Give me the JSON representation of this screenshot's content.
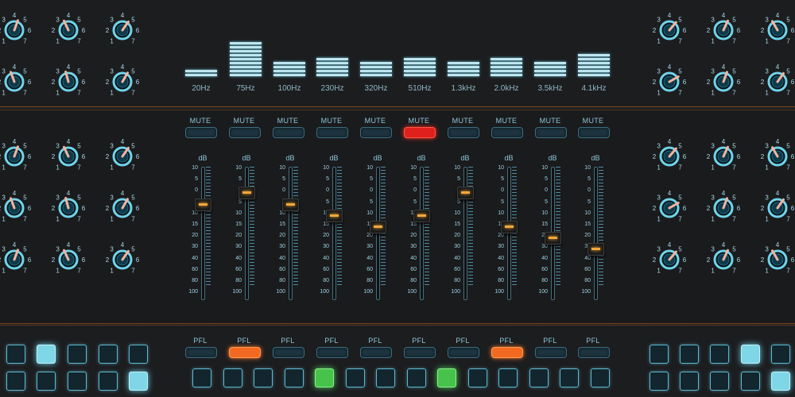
{
  "spectrum": {
    "bands": [
      {
        "label": "20Hz",
        "level": 2
      },
      {
        "label": "75Hz",
        "level": 9
      },
      {
        "label": "100Hz",
        "level": 4
      },
      {
        "label": "230Hz",
        "level": 5
      },
      {
        "label": "320Hz",
        "level": 4
      },
      {
        "label": "510Hz",
        "level": 5
      },
      {
        "label": "1.3kHz",
        "level": 4
      },
      {
        "label": "2.0kHz",
        "level": 5
      },
      {
        "label": "3.5kHz",
        "level": 4
      },
      {
        "label": "4.1kHz",
        "level": 6
      }
    ]
  },
  "knob_scale": [
    "1",
    "2",
    "3",
    "4",
    "5",
    "6",
    "7"
  ],
  "channels": [
    {
      "mute_label": "MUTE",
      "muted": false,
      "pfl_label": "PFL",
      "pfl": false,
      "db_label": "dB",
      "fader_db": 5
    },
    {
      "mute_label": "MUTE",
      "muted": false,
      "pfl_label": "PFL",
      "pfl": true,
      "db_label": "dB",
      "fader_db": 0
    },
    {
      "mute_label": "MUTE",
      "muted": false,
      "pfl_label": "PFL",
      "pfl": false,
      "db_label": "dB",
      "fader_db": 5
    },
    {
      "mute_label": "MUTE",
      "muted": false,
      "pfl_label": "PFL",
      "pfl": false,
      "db_label": "dB",
      "fader_db": 10
    },
    {
      "mute_label": "MUTE",
      "muted": false,
      "pfl_label": "PFL",
      "pfl": false,
      "db_label": "dB",
      "fader_db": 15
    },
    {
      "mute_label": "MUTE",
      "muted": true,
      "pfl_label": "PFL",
      "pfl": false,
      "db_label": "dB",
      "fader_db": 10
    },
    {
      "mute_label": "MUTE",
      "muted": false,
      "pfl_label": "PFL",
      "pfl": false,
      "db_label": "dB",
      "fader_db": 0
    },
    {
      "mute_label": "MUTE",
      "muted": false,
      "pfl_label": "PFL",
      "pfl": true,
      "db_label": "dB",
      "fader_db": 15
    },
    {
      "mute_label": "MUTE",
      "muted": false,
      "pfl_label": "PFL",
      "pfl": false,
      "db_label": "dB",
      "fader_db": 20
    },
    {
      "mute_label": "MUTE",
      "muted": false,
      "pfl_label": "PFL",
      "pfl": false,
      "db_label": "dB",
      "fader_db": 30
    }
  ],
  "fader_scale": [
    "10",
    "5",
    "0",
    "5",
    "10",
    "15",
    "20",
    "30",
    "40",
    "60",
    "80",
    "100"
  ],
  "pads_left": [
    false,
    true,
    false,
    false,
    false,
    false,
    false,
    false,
    false,
    true
  ],
  "pads_center": [
    "off",
    "off",
    "off",
    "off",
    "green",
    "off",
    "off",
    "off",
    "green",
    "off",
    "off",
    "off",
    "off",
    "off"
  ],
  "pads_right": [
    false,
    false,
    false,
    true,
    false,
    false,
    false,
    false,
    false,
    true
  ],
  "colors": {
    "accent_cyan": "#6fd4ea",
    "mute_on": "#e0201c",
    "pfl_on": "#f26a22",
    "fader_led": "#f3a73a",
    "pad_green": "#47c24a"
  }
}
